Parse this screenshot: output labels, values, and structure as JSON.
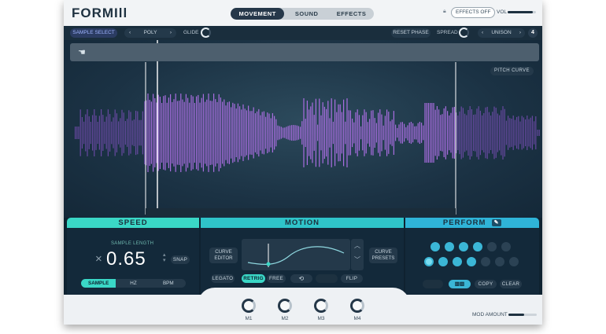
{
  "app": {
    "logo": "FORMIll"
  },
  "header": {
    "tabs": [
      {
        "label": "MOVEMENT",
        "active": true
      },
      {
        "label": "SOUND",
        "active": false
      },
      {
        "label": "EFFECTS",
        "active": false
      }
    ],
    "effects_off_label": "EFFECTS OFF",
    "vol_label": "VOL",
    "vol_level": 0.9
  },
  "subbar": {
    "sample_select": "SAMPLE SELECT",
    "poly_prev": "‹",
    "poly_value": "POLY",
    "poly_next": "›",
    "glide_label": "GLIDE",
    "reset_phase": "RESET PHASE",
    "spread_label": "SPREAD",
    "unison_prev": "‹",
    "unison_value": "UNISON",
    "unison_next": "›",
    "unison_count": "4"
  },
  "waveform": {
    "pitch_curve": "PITCH CURVE",
    "colors": {
      "bar_active": "#b070e8",
      "bar_inactive": "#7a4fb8",
      "region": "#ffffff"
    }
  },
  "sections": {
    "speed": "SPEED",
    "motion": "MOTION",
    "perform": "PERFORM",
    "perform_icon": "wrench-icon"
  },
  "speed": {
    "sub_label": "SAMPLE LENGTH",
    "prefix": "×",
    "value": "0.65",
    "snap": "SNAP",
    "modes": [
      {
        "label": "SAMPLE",
        "active": true
      },
      {
        "label": "HZ",
        "active": false
      },
      {
        "label": "BPM",
        "active": false
      }
    ]
  },
  "motion": {
    "curve_editor": [
      "CURVE",
      "EDITOR"
    ],
    "curve_presets": [
      "CURVE",
      "PRESETS"
    ],
    "legato": "LEGATO",
    "retrig": "RETRIG",
    "free": "FREE",
    "loop_icon": "loop-icon",
    "flip": "FLIP"
  },
  "perform": {
    "copy": "COPY",
    "clear": "CLEAR"
  },
  "macros": [
    {
      "label": "M1"
    },
    {
      "label": "M2"
    },
    {
      "label": "M3"
    },
    {
      "label": "M4"
    }
  ],
  "mod_amount": {
    "label": "MOD AMOUNT",
    "level": 0.55
  }
}
